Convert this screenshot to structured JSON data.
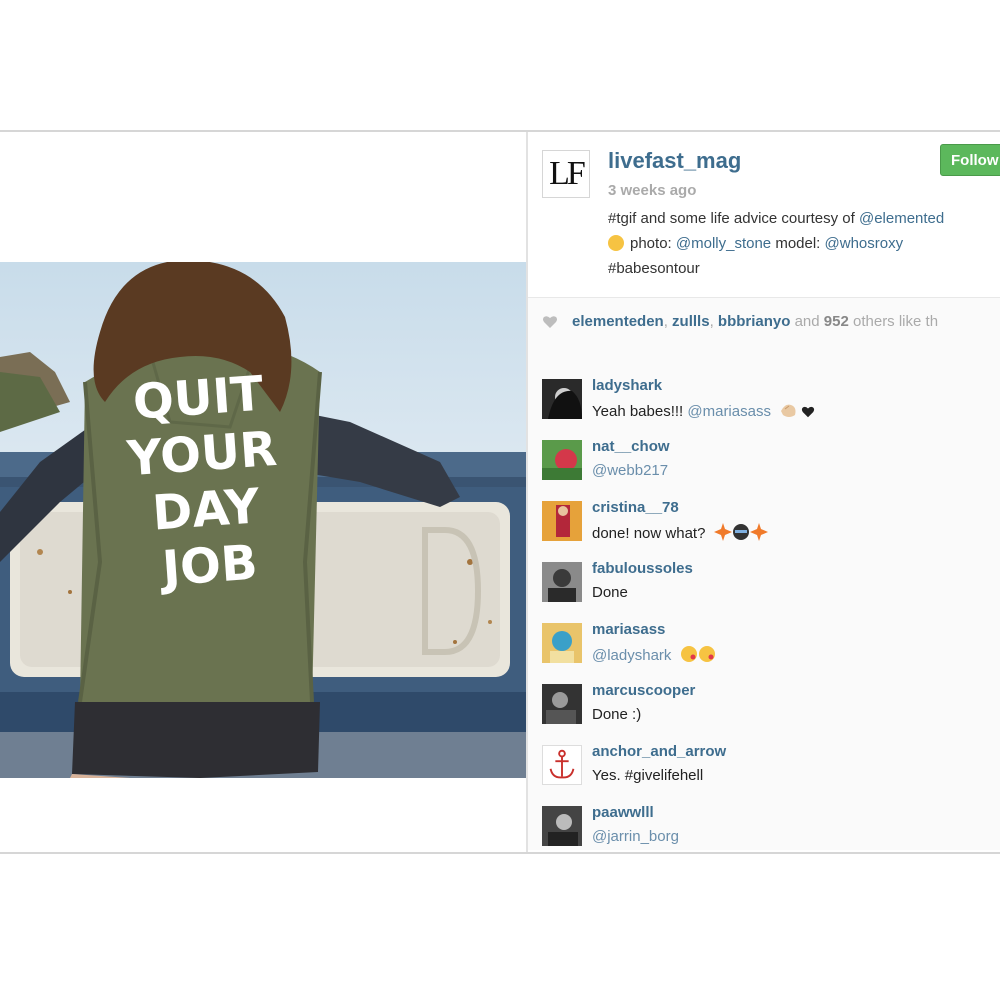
{
  "post": {
    "username": "livefast_mag",
    "logo_text": "LF",
    "time_ago": "3 weeks ago",
    "follow_label": "Follow",
    "caption_line1_text": "#tgif and some life advice courtesy of ",
    "caption_line1_mention": "@elemented",
    "caption_line2_prefix": "photo: ",
    "caption_photo_credit": "@molly_stone",
    "caption_line2_middle": " model: ",
    "caption_model_credit": "@whosroxy",
    "caption_line3": "#babesontour"
  },
  "photo": {
    "jacket_text_lines": [
      "QUIT",
      "YOUR",
      "DAY",
      "JOB"
    ]
  },
  "likes": {
    "users": [
      "elementeden",
      "zullls",
      "bbbrianyo"
    ],
    "sep1": ", ",
    "sep2": ", ",
    "and_text": " and ",
    "count": "952",
    "suffix": " others like th"
  },
  "comments": [
    {
      "user": "ladyshark",
      "text": "Yeah babes!!! ",
      "mention": "@mariasass",
      "icons": [
        "clap-hands-icon",
        "heart-icon"
      ]
    },
    {
      "user": "nat__chow",
      "text": "",
      "mention": "@webb217",
      "icons": []
    },
    {
      "user": "cristina__78",
      "text": "done! now what? ",
      "mention": "",
      "icons": [
        "sparkle-icon",
        "ninja-icon",
        "sparkle-icon"
      ]
    },
    {
      "user": "fabuloussoles",
      "text": "Done",
      "mention": "",
      "icons": []
    },
    {
      "user": "mariasass",
      "text": "",
      "mention": "@ladyshark",
      "icons": [
        "kiss-face-icon",
        "kiss-face-icon"
      ]
    },
    {
      "user": "marcuscooper",
      "text": "Done :)",
      "mention": "",
      "icons": []
    },
    {
      "user": "anchor_and_arrow",
      "text": "Yes. #givelifehell",
      "mention": "",
      "icons": []
    },
    {
      "user": "paawwlll",
      "text": "",
      "mention": "@jarrin_borg",
      "icons": []
    }
  ],
  "colors": {
    "link": "#3e6d8e",
    "follow_button": "#5cb85c",
    "jacket": "#6a7350"
  }
}
